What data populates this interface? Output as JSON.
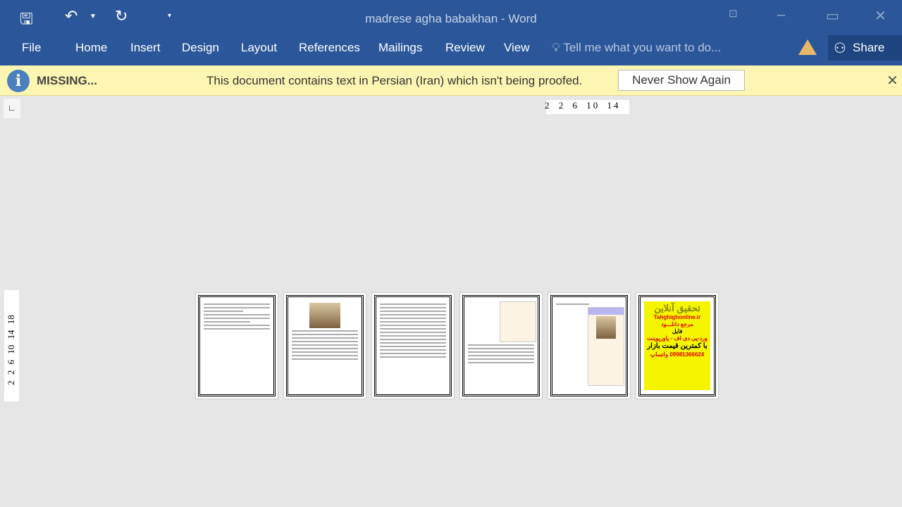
{
  "window": {
    "title": "madrese agha babakhan - Word"
  },
  "quick_access": {
    "save_icon": "save-icon",
    "undo_icon": "undo-icon",
    "redo_icon": "redo-icon",
    "customize_icon": "customize-icon"
  },
  "tabs": [
    "File",
    "Home",
    "Insert",
    "Design",
    "Layout",
    "References",
    "Mailings",
    "Review",
    "View"
  ],
  "tell_me": "Tell me what you want to do...",
  "share": "Share",
  "message_bar": {
    "label": "MISSING...",
    "text": "This document contains text in Persian (Iran) which isn't being proofed.",
    "button": "Never Show Again"
  },
  "hruler": "2 2 6 10 14",
  "vruler": "2 2 6 10 14 18",
  "ad_page": {
    "title": "تحقیق آنلاین",
    "site": "Tahghighonline.ir",
    "line1": "مرجع دانلـــود",
    "line2": "فایل",
    "line3": "ورد-پی دی اف - پاورپوینت",
    "line4": "با کمترین قیمت بازار",
    "line5": "09981366624 واتساپ"
  },
  "colors": {
    "ribbon": "#2b579a",
    "message_bar": "#fdf6b3",
    "ad": "#f5f500"
  }
}
